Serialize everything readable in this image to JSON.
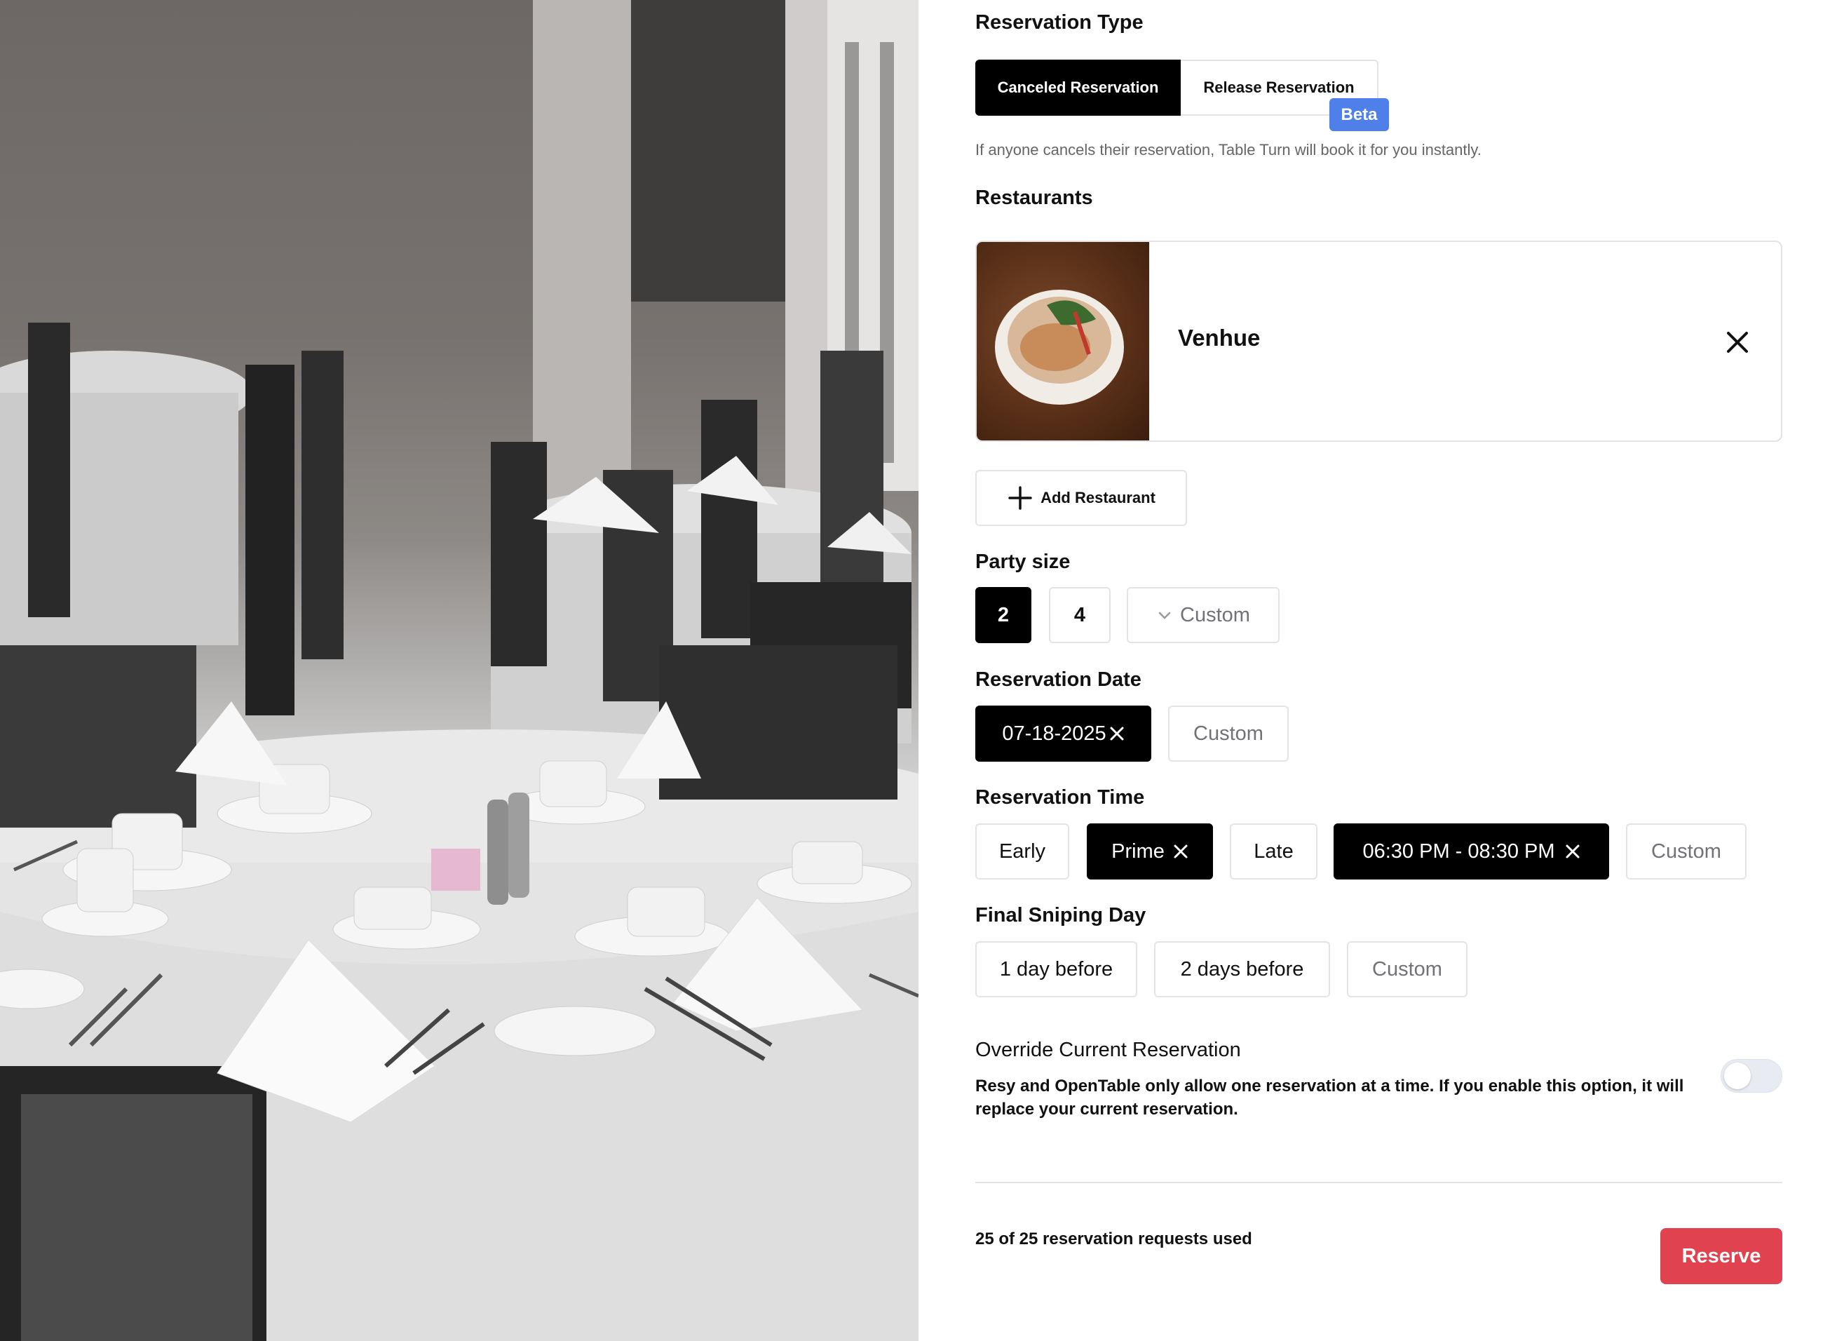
{
  "reservation_type": {
    "title": "Reservation Type",
    "options": [
      "Canceled Reservation",
      "Release Reservation"
    ],
    "selected": "Canceled Reservation",
    "beta_badge": "Beta",
    "hint": "If anyone cancels their reservation, Table Turn will book it for you instantly."
  },
  "restaurants": {
    "title": "Restaurants",
    "items": [
      {
        "name": "Venhue"
      }
    ],
    "add_label": "Add Restaurant"
  },
  "party_size": {
    "title": "Party size",
    "options": [
      "2",
      "4"
    ],
    "selected": "2",
    "custom_label": "Custom"
  },
  "reservation_date": {
    "title": "Reservation Date",
    "selected_date": "07-18-2025",
    "custom_label": "Custom"
  },
  "reservation_time": {
    "title": "Reservation Time",
    "options": [
      "Early",
      "Prime",
      "Late"
    ],
    "selected": "Prime",
    "range": "06:30 PM - 08:30 PM",
    "custom_label": "Custom"
  },
  "final_sniping_day": {
    "title": "Final Sniping Day",
    "options": [
      "1 day before",
      "2 days before"
    ],
    "custom_label": "Custom"
  },
  "override": {
    "title": "Override Current Reservation",
    "description": "Resy and OpenTable only allow one reservation at a time. If you enable this option, it will replace your current reservation.",
    "enabled": false
  },
  "footer": {
    "usage": "25 of 25 reservation requests used",
    "reserve_label": "Reserve"
  },
  "colors": {
    "accent": "#000000",
    "beta": "#4f7fe8",
    "reserve": "#e0424f",
    "border": "#e4e4e7"
  }
}
